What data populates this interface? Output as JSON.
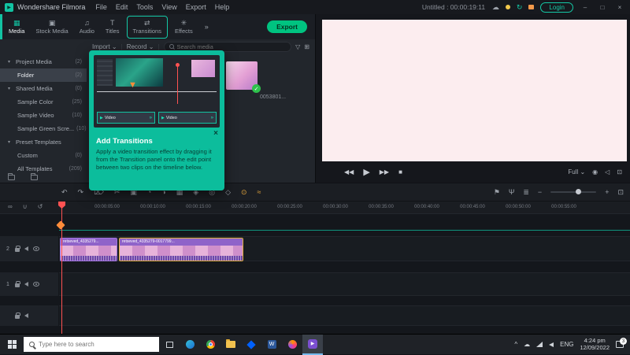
{
  "titlebar": {
    "logo_glyph": "▶",
    "app_title": "Wondershare Filmora",
    "menus": [
      "File",
      "Edit",
      "Tools",
      "View",
      "Export",
      "Help"
    ],
    "doc_title": "Untitled : 00:00:19:11",
    "cloud_glyph": "☁",
    "sync_glyph": "↻",
    "login": "Login",
    "window": {
      "minimize": "–",
      "maximize": "□",
      "close": "×"
    }
  },
  "tabs": {
    "items": [
      {
        "icon": "▦",
        "label": "Media"
      },
      {
        "icon": "▣",
        "label": "Stock Media"
      },
      {
        "icon": "♫",
        "label": "Audio"
      },
      {
        "icon": "T",
        "label": "Titles"
      },
      {
        "icon": "⇄",
        "label": "Transitions"
      },
      {
        "icon": "✳",
        "label": "Effects"
      }
    ],
    "more": "»",
    "export_label": "Export"
  },
  "media": {
    "toolbar": {
      "import": "Import",
      "record": "Record",
      "dd_caret": "⌄",
      "search_placeholder": "Search media",
      "filter_glyph": "▽",
      "grid_glyph": "⊞"
    },
    "sidebar": [
      {
        "caret": "▾",
        "label": "Project Media",
        "count": "(2)"
      },
      {
        "caret": "",
        "label": "Folder",
        "count": "(2)"
      },
      {
        "caret": "▾",
        "label": "Shared Media",
        "count": "(0)"
      },
      {
        "caret": "",
        "label": "Sample Color",
        "count": "(25)"
      },
      {
        "caret": "",
        "label": "Sample Video",
        "count": "(10)"
      },
      {
        "caret": "",
        "label": "Sample Green Scre...",
        "count": "(10)"
      },
      {
        "caret": "▾",
        "label": "Preset Templates",
        "count": ""
      },
      {
        "caret": "",
        "label": "Custom",
        "count": "(0)"
      },
      {
        "caret": "",
        "label": "All Templates",
        "count": "(209)"
      }
    ],
    "file_label": "0053801...",
    "check_glyph": "✓"
  },
  "tooltip": {
    "title": "Add Transitions",
    "body": "Apply a video transition effect by dragging it from the Transition panel onto the edit point between two clips on the timeline below.",
    "close_glyph": "×",
    "clip1": "Video",
    "clip2": "Video",
    "play_glyph": "▶",
    "chevrons": "»",
    "arrow_glyph": "▼"
  },
  "preview": {
    "transport": {
      "prev": "◀◀",
      "play": "▶",
      "next": "▶▶",
      "stop": "■"
    },
    "fit_label": "Full",
    "fit_caret": "⌄",
    "icons": [
      {
        "name": "snapshot",
        "glyph": "◉"
      },
      {
        "name": "volume",
        "glyph": "◁"
      },
      {
        "name": "fullscreen",
        "glyph": "⊡"
      }
    ]
  },
  "toolbar": {
    "left_icons": [
      {
        "name": "undo",
        "glyph": "↶"
      },
      {
        "name": "redo",
        "glyph": "↷"
      },
      {
        "name": "delete",
        "glyph": "⌦"
      },
      {
        "name": "split",
        "glyph": "✂"
      },
      {
        "name": "crop",
        "glyph": "▣"
      },
      {
        "name": "speed",
        "glyph": "◔"
      },
      {
        "name": "color",
        "glyph": "◑"
      },
      {
        "name": "chroma-key",
        "glyph": "▦"
      },
      {
        "name": "pip",
        "glyph": "◈"
      },
      {
        "name": "motion-track",
        "glyph": "◎"
      },
      {
        "name": "keyframe",
        "glyph": "◇"
      },
      {
        "name": "audio-stretch",
        "glyph": "⊙"
      },
      {
        "name": "audio-denoise",
        "glyph": "≈"
      }
    ],
    "right_icons": [
      {
        "name": "marker",
        "glyph": "⚑"
      },
      {
        "name": "voiceover",
        "glyph": "Ψ"
      },
      {
        "name": "mixer",
        "glyph": "≣"
      }
    ],
    "zoom": {
      "out": "−",
      "in": "+",
      "fit": "⊡"
    }
  },
  "timeline": {
    "tools": [
      {
        "name": "link",
        "glyph": "∞"
      },
      {
        "name": "magnet",
        "glyph": "∪"
      },
      {
        "name": "snap",
        "glyph": "↺"
      }
    ],
    "ruler": [
      "00:00:05:00",
      "00:00:10:00",
      "00:00:15:00",
      "00:00:20:00",
      "00:00:25:00",
      "00:00:30:00",
      "00:00:35:00",
      "00:00:40:00",
      "00:00:45:00",
      "00:00:50:00",
      "00:00:55:00"
    ],
    "tracks": [
      {
        "num": "2"
      },
      {
        "num": "1"
      },
      {
        "num": ""
      }
    ],
    "clips": [
      {
        "label": "retseved_4335279..."
      },
      {
        "label": "retseved_4335279-0017799..."
      }
    ]
  },
  "taskbar": {
    "search_placeholder": "Type here to search",
    "word_glyph": "W",
    "filmora_glyph": "▶",
    "tray": {
      "chevron": "^",
      "cloud": "☁",
      "lang": "ENG",
      "time": "4:24 pm",
      "date": "12/09/2022",
      "badge": "3"
    }
  }
}
